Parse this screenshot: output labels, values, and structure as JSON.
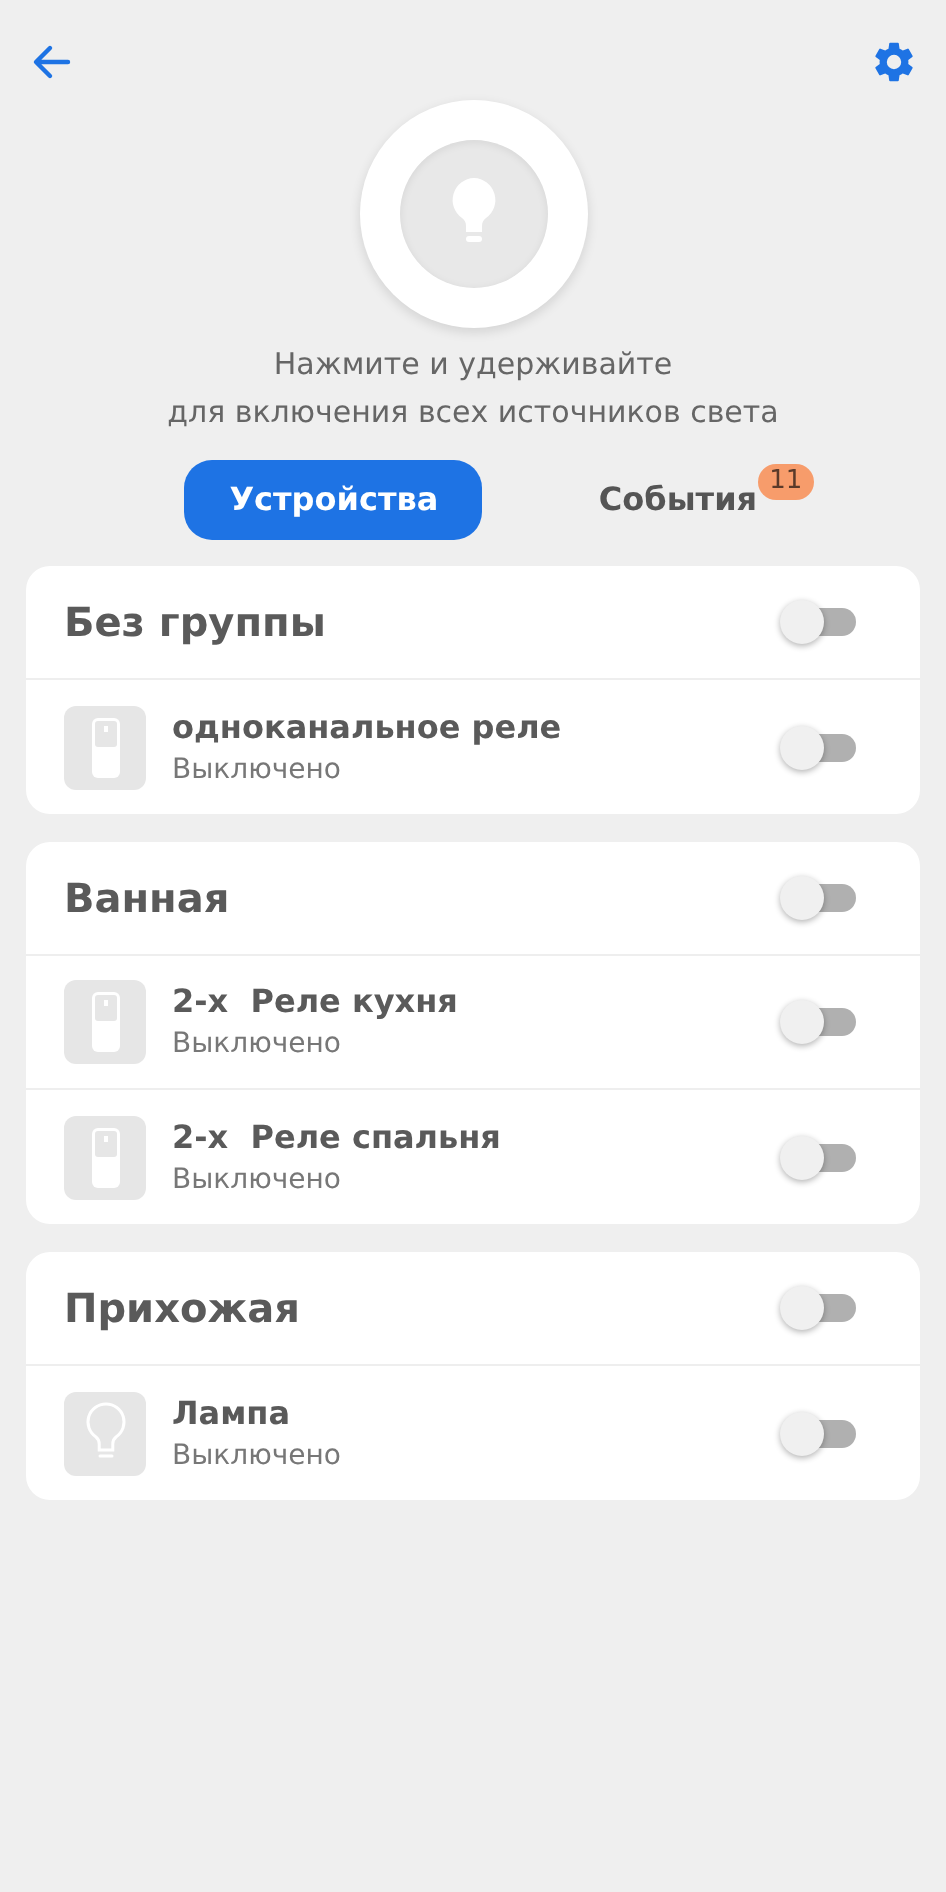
{
  "hint": [
    "Нажмите и удерживайте",
    "для включения всех источников света"
  ],
  "tabs": [
    {
      "label": "Устройства",
      "selected": true
    },
    {
      "label": "События",
      "selected": false,
      "badge": "11"
    }
  ],
  "groups": [
    {
      "name": "Без группы",
      "on": false,
      "devices": [
        {
          "kind": "relay",
          "name": "одноканальное реле",
          "status": "Выключено",
          "on": false
        }
      ]
    },
    {
      "name": "Ванная",
      "on": false,
      "devices": [
        {
          "kind": "relay",
          "name": "2-х  Реле кухня",
          "status": "Выключено",
          "on": false
        },
        {
          "kind": "relay",
          "name": "2-х  Реле спальня",
          "status": "Выключено",
          "on": false
        }
      ]
    },
    {
      "name": "Прихожая",
      "on": false,
      "devices": [
        {
          "kind": "lamp",
          "name": "Лампа",
          "status": "Выключено",
          "on": false
        }
      ]
    }
  ]
}
